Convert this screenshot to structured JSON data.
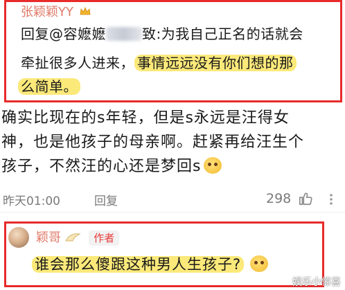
{
  "reply_quote": {
    "username": "张颖颖YY",
    "line1_prefix": "回复@容嬷嬷",
    "line1_suffix": "致:为我自己正名的话就会",
    "line2_plain": "牵扯很多人进来，",
    "line2_highlight": "事情远远没有你们想的那",
    "line3_highlight": "么简单。"
  },
  "comment": {
    "line1": "确实比现在的s年轻，但是s永远是汪得女",
    "line2": "神，也是他孩子的母亲啊。赶紧再给汪生个",
    "line3": "孩子，不然汪的心还是梦回s",
    "timestamp": "昨天01:00",
    "reply_label": "回复",
    "like_count": "298"
  },
  "author_reply": {
    "username": "颖哥",
    "author_badge": "作者",
    "text": "谁会那么傻跟这种男人生孩子?"
  },
  "watermark": "娱乐小惊喜",
  "colors": {
    "highlight": "#fbe97a",
    "frame_red": "#e82a2a",
    "username": "#e07b6a"
  }
}
